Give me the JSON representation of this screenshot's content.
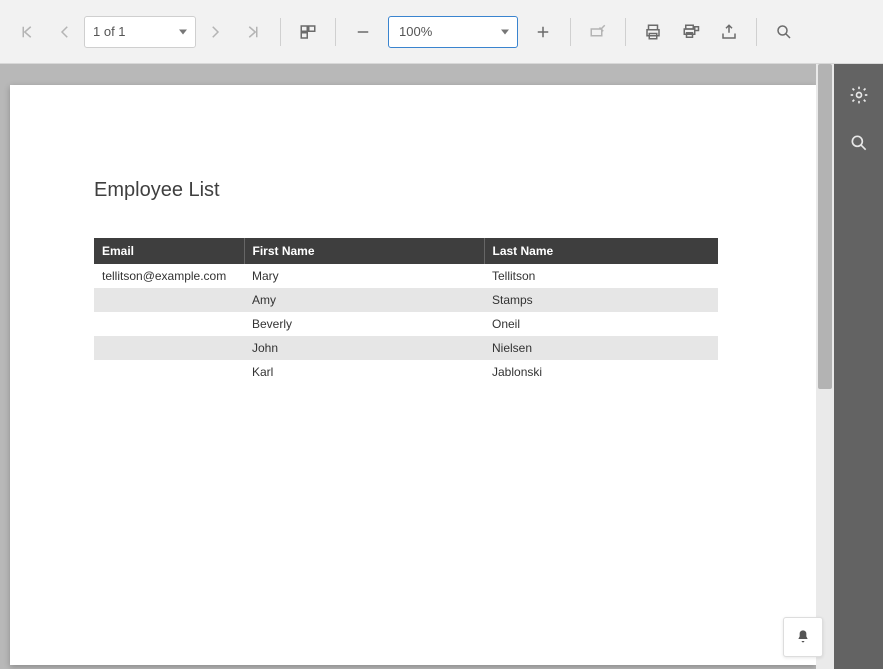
{
  "toolbar": {
    "page_label": "1 of 1",
    "zoom_label": "100%"
  },
  "report": {
    "title": "Employee List",
    "columns": [
      "Email",
      "First Name",
      "Last Name"
    ],
    "rows": [
      {
        "email": "tellitson@example.com",
        "first": "Mary",
        "last": "Tellitson"
      },
      {
        "email": "",
        "first": "Amy",
        "last": "Stamps"
      },
      {
        "email": "",
        "first": "Beverly",
        "last": "Oneil"
      },
      {
        "email": "",
        "first": "John",
        "last": "Nielsen"
      },
      {
        "email": "",
        "first": "Karl",
        "last": "Jablonski"
      }
    ]
  }
}
